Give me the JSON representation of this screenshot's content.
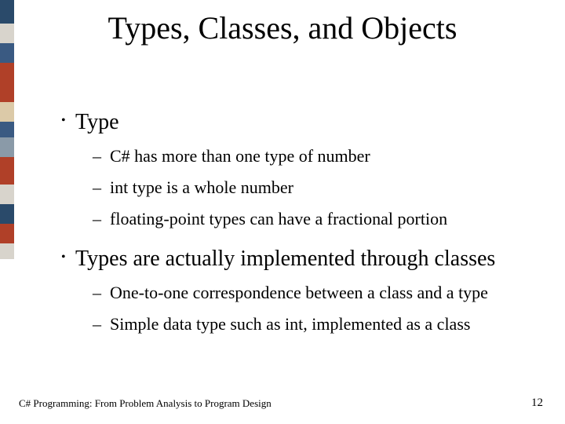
{
  "title": "Types, Classes, and Objects",
  "bullets": {
    "b1": {
      "label": "Type",
      "subs": [
        "C# has more than one type of number",
        "int type is a whole number",
        "floating-point types can have a fractional portion"
      ]
    },
    "b2": {
      "label": "Types are actually implemented through classes",
      "subs": [
        "One-to-one correspondence between a class and a type",
        "Simple data type such as int, implemented as a class"
      ]
    }
  },
  "footer": {
    "source": "C# Programming: From Problem Analysis to Program Design",
    "page": "12"
  }
}
